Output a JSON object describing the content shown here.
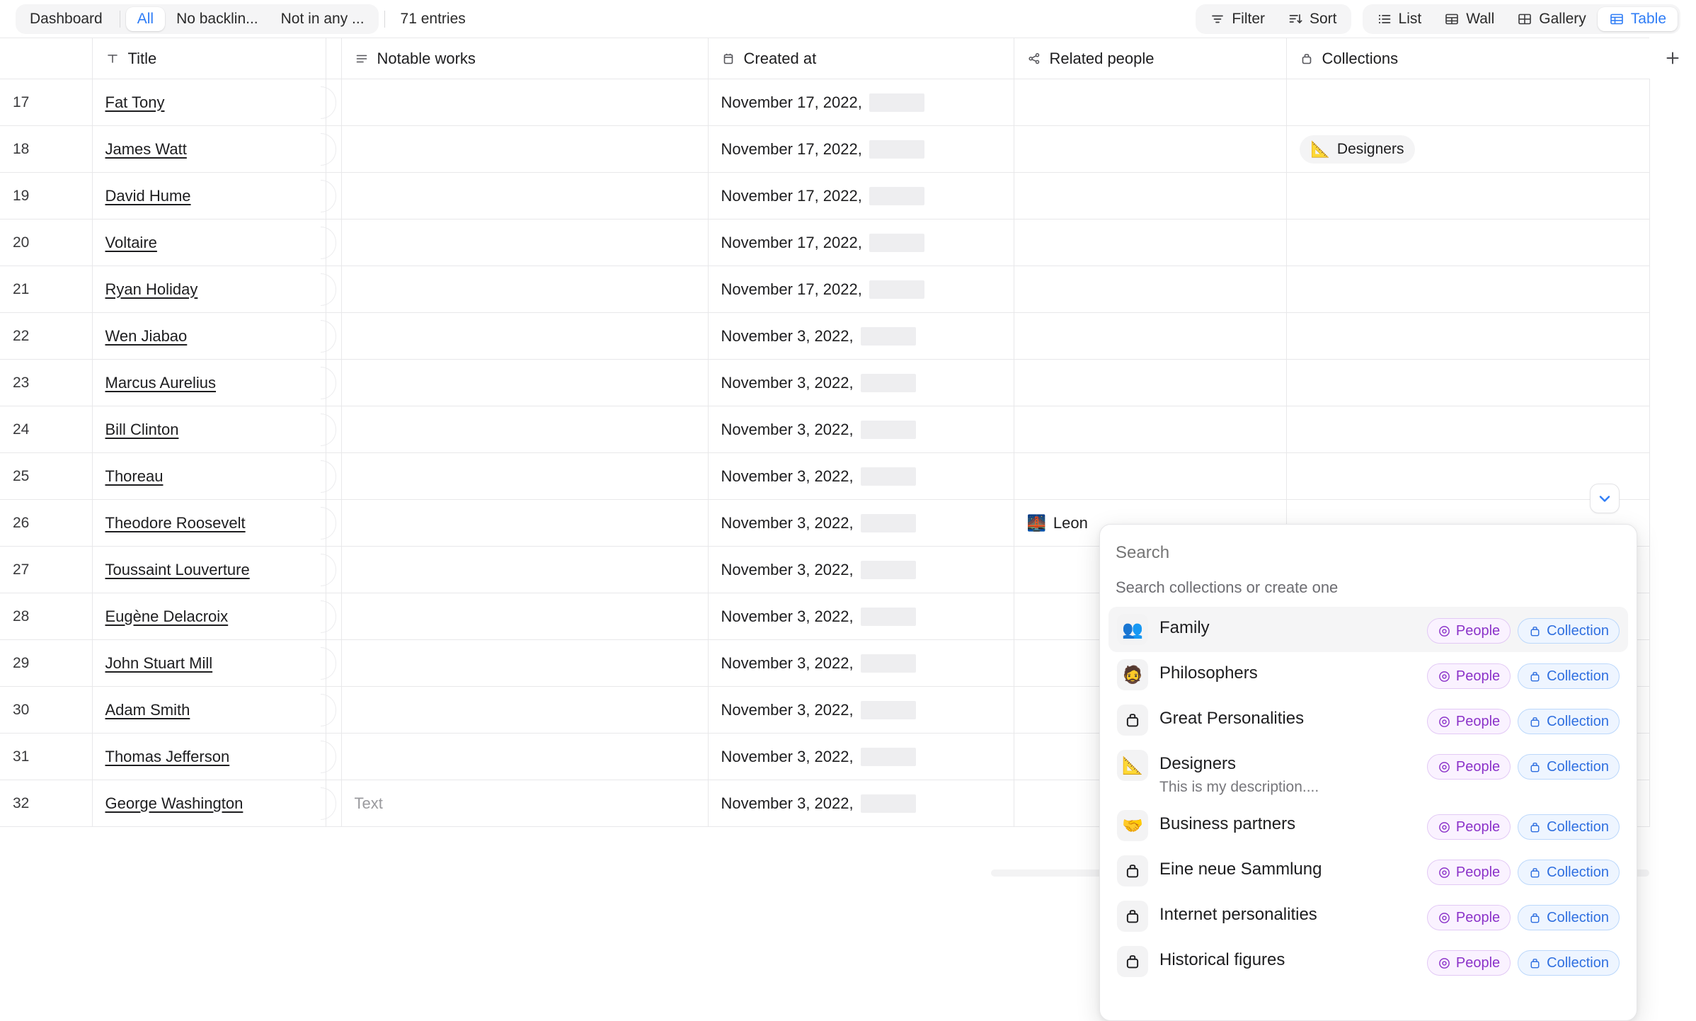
{
  "toolbar": {
    "left_group": [
      {
        "label": "Dashboard",
        "active": false
      },
      {
        "label": "All",
        "active": true
      },
      {
        "label": "No backlin...",
        "active": false
      },
      {
        "label": "Not in any ...",
        "active": false
      }
    ],
    "entries_count": "71 entries",
    "filter_label": "Filter",
    "sort_label": "Sort",
    "views": [
      {
        "label": "List",
        "active": false
      },
      {
        "label": "Wall",
        "active": false
      },
      {
        "label": "Gallery",
        "active": false
      },
      {
        "label": "Table",
        "active": true
      }
    ]
  },
  "table": {
    "columns": [
      {
        "key": "num",
        "label": "",
        "icon": ""
      },
      {
        "key": "title",
        "label": "Title",
        "icon": "text-type-icon"
      },
      {
        "key": "works",
        "label": "Notable works",
        "icon": "rich-text-icon"
      },
      {
        "key": "date",
        "label": "Created at",
        "icon": "calendar-icon"
      },
      {
        "key": "people",
        "label": "Related people",
        "icon": "relation-icon"
      },
      {
        "key": "coll",
        "label": "Collections",
        "icon": "collection-icon"
      }
    ],
    "works_placeholder": "Text",
    "add_column_label": "+",
    "rows": [
      {
        "num": "17",
        "title": "Fat Tony",
        "works": "",
        "date": "November 17, 2022,",
        "people": "",
        "people_emoji": "",
        "collection": ""
      },
      {
        "num": "18",
        "title": "James Watt",
        "works": "",
        "date": "November 17, 2022,",
        "people": "",
        "people_emoji": "",
        "collection": "Designers",
        "collection_emoji": "📐"
      },
      {
        "num": "19",
        "title": "David Hume",
        "works": "",
        "date": "November 17, 2022,",
        "people": "",
        "people_emoji": "",
        "collection": ""
      },
      {
        "num": "20",
        "title": "Voltaire",
        "works": "",
        "date": "November 17, 2022,",
        "people": "",
        "people_emoji": "",
        "collection": ""
      },
      {
        "num": "21",
        "title": "Ryan Holiday",
        "works": "",
        "date": "November 17, 2022,",
        "people": "",
        "people_emoji": "",
        "collection": ""
      },
      {
        "num": "22",
        "title": "Wen Jiabao",
        "works": "",
        "date": "November 3, 2022,",
        "people": "",
        "people_emoji": "",
        "collection": ""
      },
      {
        "num": "23",
        "title": "Marcus Aurelius",
        "works": "",
        "date": "November 3, 2022,",
        "people": "",
        "people_emoji": "",
        "collection": ""
      },
      {
        "num": "24",
        "title": "Bill Clinton",
        "works": "",
        "date": "November 3, 2022,",
        "people": "",
        "people_emoji": "",
        "collection": ""
      },
      {
        "num": "25",
        "title": "Thoreau",
        "works": "",
        "date": "November 3, 2022,",
        "people": "",
        "people_emoji": "",
        "collection": ""
      },
      {
        "num": "26",
        "title": "Theodore Roosevelt",
        "works": "",
        "date": "November 3, 2022,",
        "people": "Leon",
        "people_emoji": "🌉",
        "collection": ""
      },
      {
        "num": "27",
        "title": "Toussaint Louverture",
        "works": "",
        "date": "November 3, 2022,",
        "people": "",
        "people_emoji": "",
        "collection": ""
      },
      {
        "num": "28",
        "title": "Eugène Delacroix",
        "works": "",
        "date": "November 3, 2022,",
        "people": "",
        "people_emoji": "",
        "collection": ""
      },
      {
        "num": "29",
        "title": "John Stuart Mill",
        "works": "",
        "date": "November 3, 2022,",
        "people": "",
        "people_emoji": "",
        "collection": ""
      },
      {
        "num": "30",
        "title": "Adam Smith",
        "works": "",
        "date": "November 3, 2022,",
        "people": "",
        "people_emoji": "",
        "collection": ""
      },
      {
        "num": "31",
        "title": "Thomas Jefferson",
        "works": "",
        "date": "November 3, 2022,",
        "people": "",
        "people_emoji": "",
        "collection": ""
      },
      {
        "num": "32",
        "title": "George Washington",
        "works": "Text",
        "works_is_placeholder": true,
        "date": "November 3, 2022,",
        "people": "",
        "people_emoji": "",
        "collection": ""
      }
    ]
  },
  "popover": {
    "search_placeholder": "Search",
    "hint": "Search collections or create one",
    "tag_people": "People",
    "tag_collection": "Collection",
    "items": [
      {
        "name": "Family",
        "emoji": "👥",
        "icon": "people-group-icon",
        "desc": "",
        "highlighted": true
      },
      {
        "name": "Philosophers",
        "emoji": "🧔",
        "icon": "bearded-person-emoji",
        "desc": "",
        "highlighted": false
      },
      {
        "name": "Great Personalities",
        "emoji": "",
        "icon": "collection-icon",
        "desc": "",
        "highlighted": false
      },
      {
        "name": "Designers",
        "emoji": "📐",
        "icon": "triangular-ruler-emoji",
        "desc": "This is my description....",
        "highlighted": false
      },
      {
        "name": "Business partners",
        "emoji": "🤝",
        "icon": "handshake-emoji",
        "desc": "",
        "highlighted": false
      },
      {
        "name": "Eine neue Sammlung",
        "emoji": "",
        "icon": "collection-icon",
        "desc": "",
        "highlighted": false
      },
      {
        "name": "Internet personalities",
        "emoji": "",
        "icon": "collection-icon",
        "desc": "",
        "highlighted": false
      },
      {
        "name": "Historical figures",
        "emoji": "",
        "icon": "collection-icon",
        "desc": "",
        "highlighted": false
      }
    ]
  },
  "colors": {
    "accent": "#2f7df6",
    "tag_people": "#8b32c9",
    "tag_collection": "#2f6fe0",
    "border": "#e8e8ea"
  }
}
